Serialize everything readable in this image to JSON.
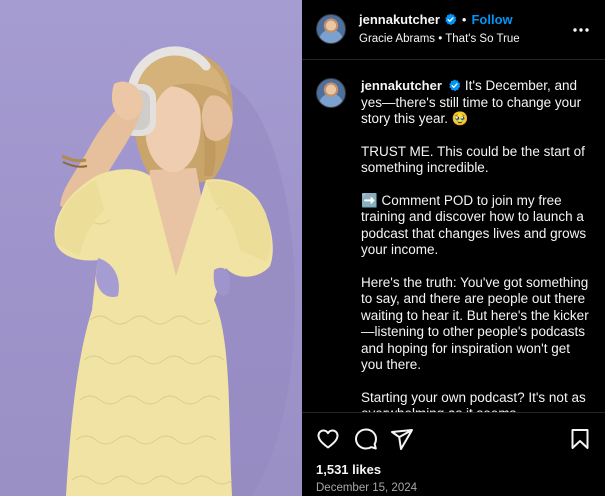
{
  "post": {
    "author": "jennakutcher",
    "follow_label": "Follow",
    "separator": "•",
    "audio": "Gracie Abrams • That's So True",
    "caption_lines": [
      "It's December, and yes—there's still time to change your story this year. 🥹",
      "TRUST ME. This could be the start of something incredible.",
      "➡️ Comment POD to join my free training and discover how to launch a podcast that changes lives and grows your income.",
      "Here's the truth: You've got something to say, and there are people out there waiting to hear it. But here's the kicker—listening to other people's podcasts and hoping for inspiration won't get you there.",
      "Starting your own podcast? It's not as overwhelming as it seems."
    ],
    "likes": "1,531 likes",
    "date": "December 15, 2024"
  },
  "icons": {
    "verified": "verified-badge-icon",
    "more": "more-options-icon",
    "like": "heart-icon",
    "comment": "comment-icon",
    "share": "send-icon",
    "save": "bookmark-icon"
  },
  "colors": {
    "background": "#000000",
    "follow": "#0095f6",
    "verified": "#0095f6",
    "photo_backdrop": "#a59cd2",
    "dress": "#f1e3a4",
    "secondary_text": "#a8a8a8"
  }
}
